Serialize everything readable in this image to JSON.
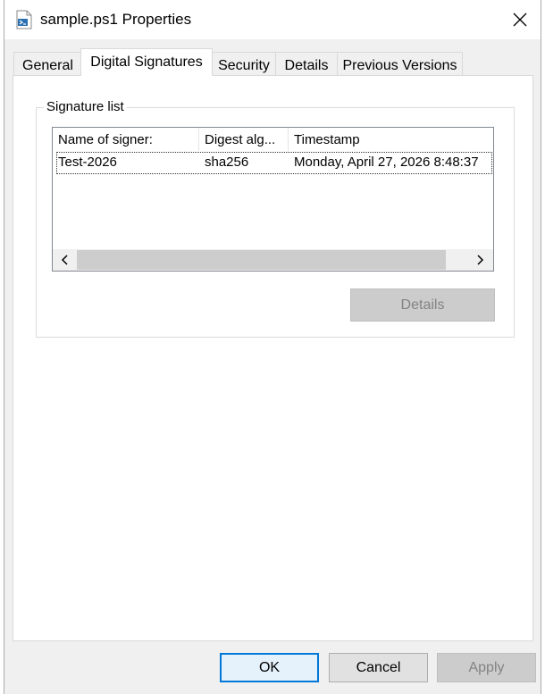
{
  "window": {
    "title": "sample.ps1 Properties",
    "title_icon": "powershell-file-icon",
    "close_icon": "close-icon"
  },
  "tabs": [
    {
      "label": "General",
      "active": false
    },
    {
      "label": "Digital Signatures",
      "active": true
    },
    {
      "label": "Security",
      "active": false
    },
    {
      "label": "Details",
      "active": false
    },
    {
      "label": "Previous Versions",
      "active": false
    }
  ],
  "signatures": {
    "group_label": "Signature list",
    "columns": [
      "Name of signer:",
      "Digest alg...",
      "Timestamp"
    ],
    "rows": [
      {
        "signer": "Test-2026",
        "digest": "sha256",
        "timestamp": "Monday, April 27, 2026 8:48:37"
      }
    ],
    "details_button": "Details"
  },
  "footer": {
    "ok": "OK",
    "cancel": "Cancel",
    "apply": "Apply"
  },
  "colors": {
    "focus_border": "#0078d7",
    "disabled_text": "#838383"
  }
}
